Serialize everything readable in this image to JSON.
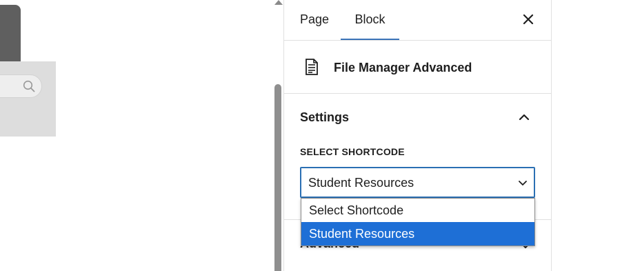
{
  "sidebar": {
    "tabs": [
      {
        "label": "Page",
        "active": false
      },
      {
        "label": "Block",
        "active": true
      }
    ],
    "close_icon": "close-icon",
    "block": {
      "icon": "document-icon",
      "title": "File Manager Advanced"
    },
    "settings": {
      "title": "Settings",
      "expanded": true,
      "field_label": "SELECT SHORTCODE",
      "selected_value": "Student Resources",
      "options": [
        "Select Shortcode",
        "Student Resources"
      ],
      "highlighted_option": "Student Resources"
    },
    "advanced": {
      "title": "Advanced"
    }
  },
  "colors": {
    "accent": "#3a73b8",
    "select_border": "#2a6fb3",
    "option_highlight": "#1e6fd6"
  }
}
